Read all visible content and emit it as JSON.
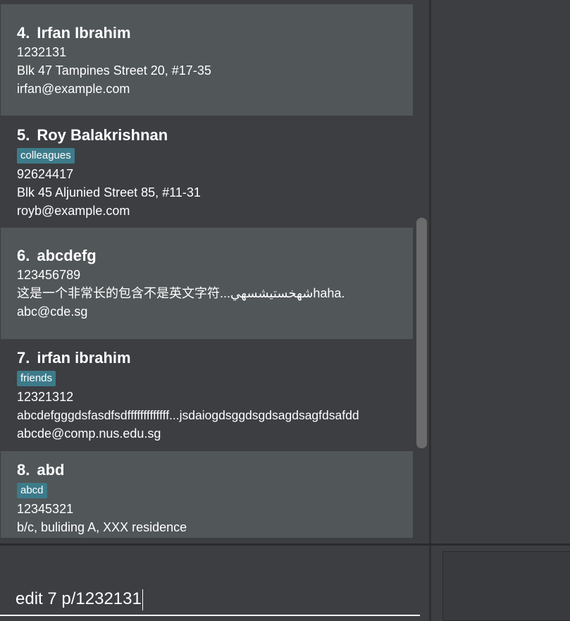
{
  "persons": [
    {
      "index": "4.",
      "name": "Irfan Ibrahim",
      "tags": [],
      "phone": "1232131",
      "address": "Blk 47 Tampines Street 20, #17-35",
      "email": "irfan@example.com"
    },
    {
      "index": "5.",
      "name": "Roy Balakrishnan",
      "tags": [
        "colleagues"
      ],
      "phone": "92624417",
      "address": "Blk 45 Aljunied Street 85, #11-31",
      "email": "royb@example.com"
    },
    {
      "index": "6.",
      "name": "abcdefg",
      "tags": [],
      "phone": "123456789",
      "address": "这是一个非常长的包含不是英文字符...شهخستيشسهيhaha.",
      "email": "abc@cde.sg"
    },
    {
      "index": "7.",
      "name": "irfan ibrahim",
      "tags": [
        "friends"
      ],
      "phone": "12321312",
      "address": "abcdefgggdsfasdfsdfffffffffffff...jsdaiogdsggdsgdsagdsagfdsafdd",
      "email": "abcde@comp.nus.edu.sg"
    },
    {
      "index": "8.",
      "name": "abd",
      "tags": [
        "abcd"
      ],
      "phone": "12345321",
      "address": "b/c, buliding A, XXX residence",
      "email": ""
    }
  ],
  "command": {
    "value": "edit 7 p/1232131"
  },
  "colors": {
    "card_light": "#515658",
    "card_dark": "#3c3e42",
    "tag_bg": "#3d7b8a",
    "text": "#ffffff"
  }
}
